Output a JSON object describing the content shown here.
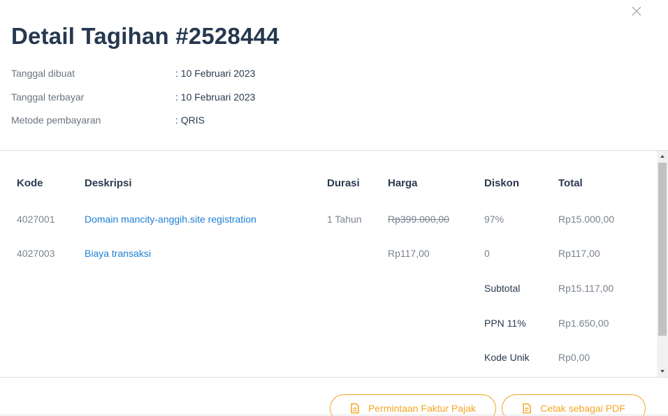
{
  "modal": {
    "title": "Detail Tagihan #2528444",
    "close_icon": "close-icon"
  },
  "meta": [
    {
      "label": "Tanggal dibuat",
      "value": ": 10 Februari 2023"
    },
    {
      "label": "Tanggal terbayar",
      "value": ": 10 Februari 2023"
    },
    {
      "label": "Metode pembayaran",
      "value": ": QRIS"
    }
  ],
  "table": {
    "headers": {
      "code": "Kode",
      "description": "Deskripsi",
      "duration": "Durasi",
      "price": "Harga",
      "discount": "Diskon",
      "total": "Total"
    },
    "rows": [
      {
        "code": "4027001",
        "description": "Domain mancity-anggih.site registration",
        "duration": "1 Tahun",
        "price": "Rp399.000,00",
        "discount": "97%",
        "total": "Rp15.000,00"
      },
      {
        "code": "4027003",
        "description": "Biaya transaksi",
        "duration": "",
        "price": "Rp117,00",
        "discount": "0",
        "total": "Rp117,00"
      }
    ],
    "summary": [
      {
        "label": "Subtotal",
        "value": "Rp15.117,00"
      },
      {
        "label": "PPN 11%",
        "value": "Rp1.650,00"
      },
      {
        "label": "Kode Unik",
        "value": "Rp0,00"
      }
    ]
  },
  "actions": {
    "tax_invoice": "Permintaan Faktur Pajak",
    "print_pdf": "Cetak sebagai PDF"
  },
  "colors": {
    "accent": "#f5a623",
    "link": "#1c7fd6",
    "title": "#263850"
  }
}
